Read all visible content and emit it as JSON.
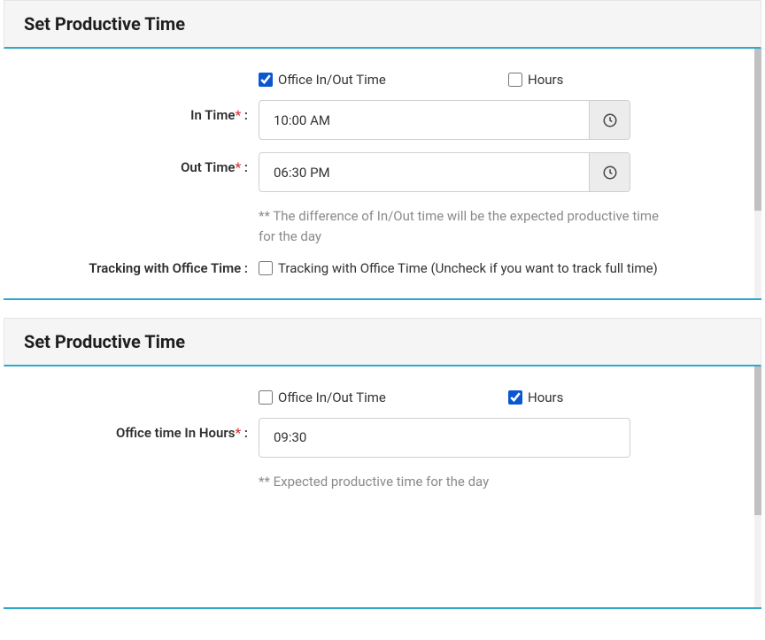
{
  "panel1": {
    "title": "Set Productive Time",
    "checkboxes": {
      "office_label": "Office In/Out Time",
      "office_checked": true,
      "hours_label": "Hours",
      "hours_checked": false
    },
    "in_time": {
      "label": "In Time",
      "value": "10:00 AM"
    },
    "out_time": {
      "label": "Out Time",
      "value": "06:30 PM"
    },
    "hint": "** The difference of In/Out time will be the expected productive time for the day",
    "tracking": {
      "label": "Tracking with Office Time :",
      "checkbox_label": "Tracking with Office Time (Uncheck if you want to track full time)",
      "checked": false
    }
  },
  "panel2": {
    "title": "Set Productive Time",
    "checkboxes": {
      "office_label": "Office In/Out Time",
      "office_checked": false,
      "hours_label": "Hours",
      "hours_checked": true
    },
    "office_hours": {
      "label": "Office time In Hours",
      "value": "09:30"
    },
    "hint": "** Expected productive time for the day"
  },
  "symbols": {
    "asterisk": "*",
    "colon": " :"
  }
}
